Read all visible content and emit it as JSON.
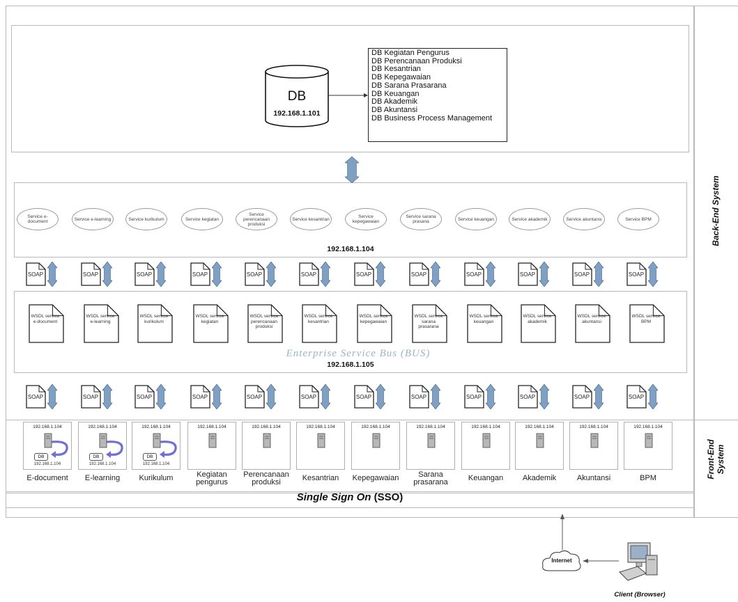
{
  "db": {
    "label": "DB",
    "ip": "192.168.1.101",
    "databases": [
      "DB Kegiatan Pengurus",
      "DB Perencanaan Produksi",
      "DB Kesantrian",
      "DB Kepegawaian",
      "DB Sarana Prasarana",
      "DB Keuangan",
      "DB Akademik",
      "DB Akuntansi",
      "DB Business Process Management"
    ]
  },
  "services": {
    "ip": "192.168.1.104",
    "items": [
      "Service e-document",
      "Service e-learning",
      "Service kurikulum",
      "Service kegiatan",
      "Service perencanaan produksi",
      "Service kesantrian",
      "Service kepegawaian",
      "Service sarana prasana",
      "Service keuangan",
      "Service akademik",
      "Service akuntansi",
      "Service BPM"
    ]
  },
  "soap_label": "SOAP",
  "esb": {
    "title": "Enterprise Service Bus (BUS)",
    "ip": "192.168.1.105",
    "wsdl": [
      "WSDL service e-document",
      "WSDL service e-learning",
      "WSDL service kurikulum",
      "WSDL service kegiatan",
      "WSDL service perencanaan produksi",
      "WSDL service kesantrian",
      "WSDL service kepegawaian",
      "WSDL service sarana prasarana",
      "WSDL service keuangan",
      "WSDL service akademik",
      "WSDL service akuntansi",
      "WSDL service BPM"
    ]
  },
  "frontend": {
    "server_ip": "192.168.1.104",
    "local_db_label": "DB",
    "local_db_ip": "192.168.1.104",
    "apps": [
      {
        "label": "E-document",
        "has_db": true
      },
      {
        "label": "E-learning",
        "has_db": true
      },
      {
        "label": "Kurikulum",
        "has_db": true
      },
      {
        "label": "Kegiatan pengurus",
        "has_db": false
      },
      {
        "label": "Perencanaan produksi",
        "has_db": false
      },
      {
        "label": "Kesantrian",
        "has_db": false
      },
      {
        "label": "Kepegawaian",
        "has_db": false
      },
      {
        "label": "Sarana prasarana",
        "has_db": false
      },
      {
        "label": "Keuangan",
        "has_db": false
      },
      {
        "label": "Akademik",
        "has_db": false
      },
      {
        "label": "Akuntansi",
        "has_db": false
      },
      {
        "label": "BPM",
        "has_db": false
      }
    ]
  },
  "sso": {
    "italic": "Single Sign On",
    "bold": "(SSO)"
  },
  "side": {
    "backend": "Back-End System",
    "frontend": "Front-End System"
  },
  "client": {
    "internet": "Internet",
    "client": "Client (Browser)"
  },
  "colors": {
    "arrow": "#7f9fc3",
    "arrow_dark": "#5c7ea8",
    "esb_text": "#9ab5c6",
    "loop_arrow": "#6f6fd6"
  }
}
